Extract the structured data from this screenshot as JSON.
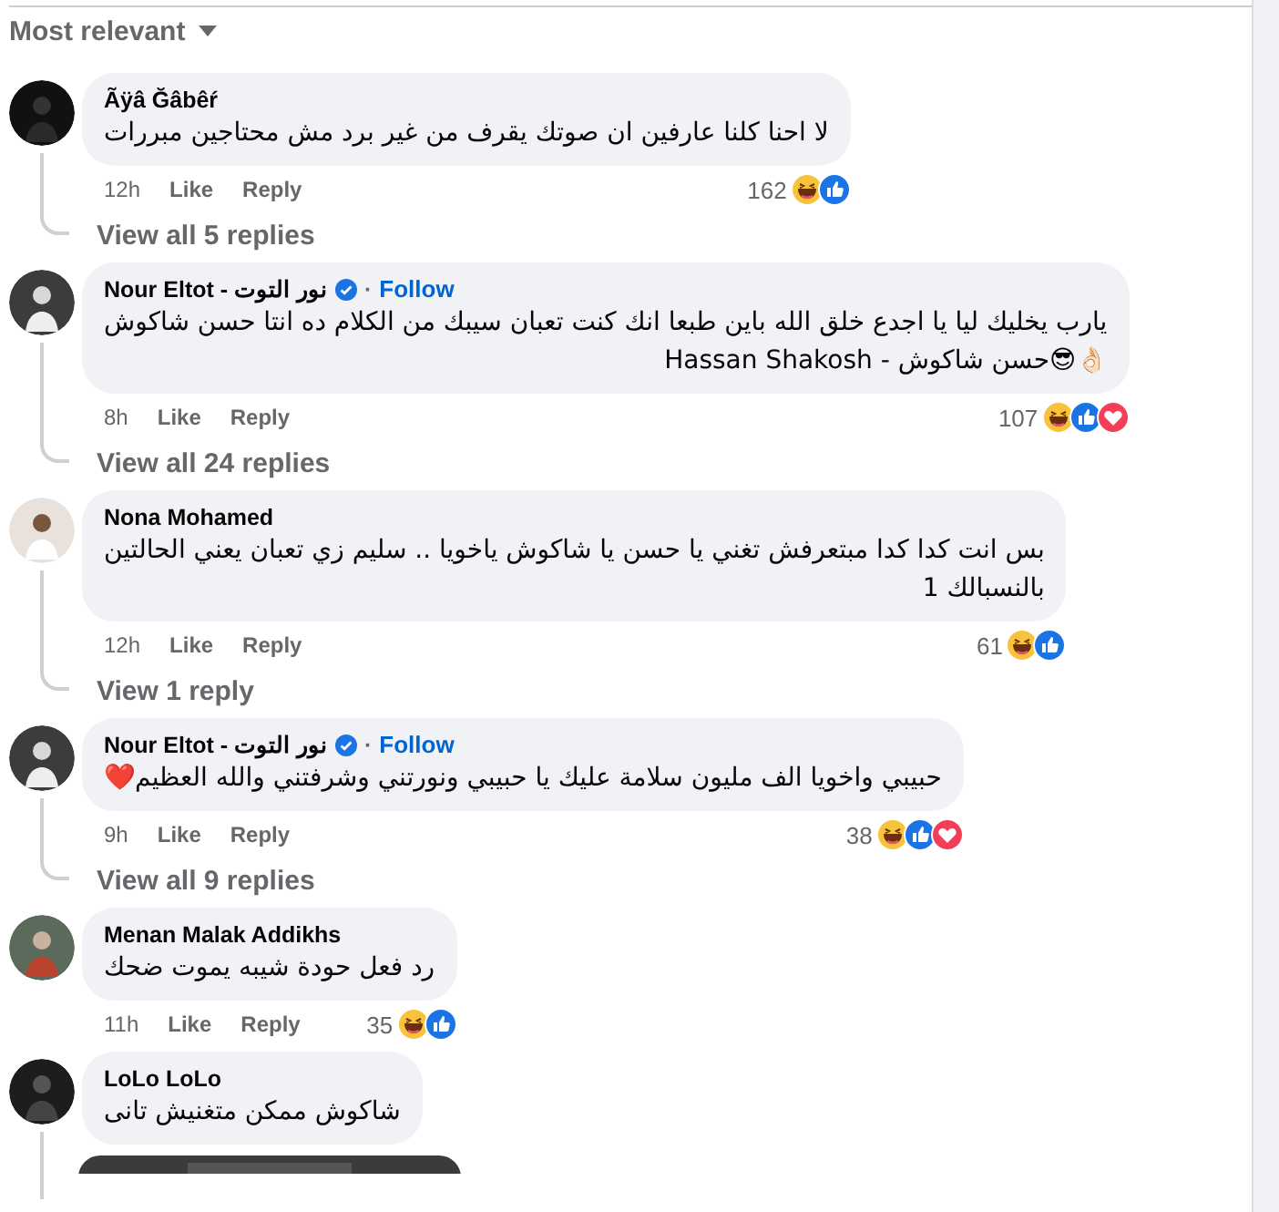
{
  "sort": {
    "label": "Most relevant"
  },
  "comments": [
    {
      "author": "Ãÿâ Ğâbêŕ",
      "text": "لا احنا كلنا عارفين ان صوتك يقرف من غير برد مش محتاجين مبررات",
      "time": "12h",
      "like": "Like",
      "reply": "Reply",
      "count": "162",
      "reactions": [
        {
          "kind": "haha"
        },
        {
          "kind": "like"
        }
      ],
      "replies_link": "View all 5 replies",
      "thread": true
    },
    {
      "author": "Nour Eltot - نور التوت",
      "verified": true,
      "separator": "·",
      "follow": "Follow",
      "text": "يارب يخليك ليا يا اجدع خلق الله باين طبعا انك كنت تعبان سيبك من الكلام ده انتا حسن شاكوش\n👌🏻😎حسن شاكوش - Hassan Shakosh",
      "time": "8h",
      "like": "Like",
      "reply": "Reply",
      "count": "107",
      "reactions": [
        {
          "kind": "haha"
        },
        {
          "kind": "like"
        },
        {
          "kind": "love"
        }
      ],
      "replies_link": "View all 24 replies",
      "thread": true
    },
    {
      "author": "Nona Mohamed",
      "text": "بس انت كدا كدا مبتعرفش تغني يا حسن يا شاكوش ياخويا .. سليم زي تعبان يعني الحالتين\nبالنسبالك 1",
      "time": "12h",
      "like": "Like",
      "reply": "Reply",
      "count": "61",
      "reactions": [
        {
          "kind": "haha"
        },
        {
          "kind": "like"
        }
      ],
      "replies_link": "View 1 reply",
      "thread": true
    },
    {
      "author": "Nour Eltot - نور التوت",
      "verified": true,
      "separator": "·",
      "follow": "Follow",
      "text": "حبيبي واخويا الف مليون سلامة عليك يا حبيبي ونورتني وشرفتني والله العظيم❤️",
      "time": "9h",
      "like": "Like",
      "reply": "Reply",
      "count": "38",
      "reactions": [
        {
          "kind": "haha"
        },
        {
          "kind": "like"
        },
        {
          "kind": "love"
        }
      ],
      "replies_link": "View all 9 replies",
      "thread": true
    },
    {
      "author": "Menan Malak Addikhs",
      "text": "رد فعل حودة شيبه يموت ضحك",
      "time": "11h",
      "like": "Like",
      "reply": "Reply",
      "count": "35",
      "reactions": [
        {
          "kind": "haha"
        },
        {
          "kind": "like"
        }
      ]
    },
    {
      "author": "LoLo LoLo",
      "text": "شاكوش ممكن متغنيش تانى",
      "thread": true
    }
  ]
}
